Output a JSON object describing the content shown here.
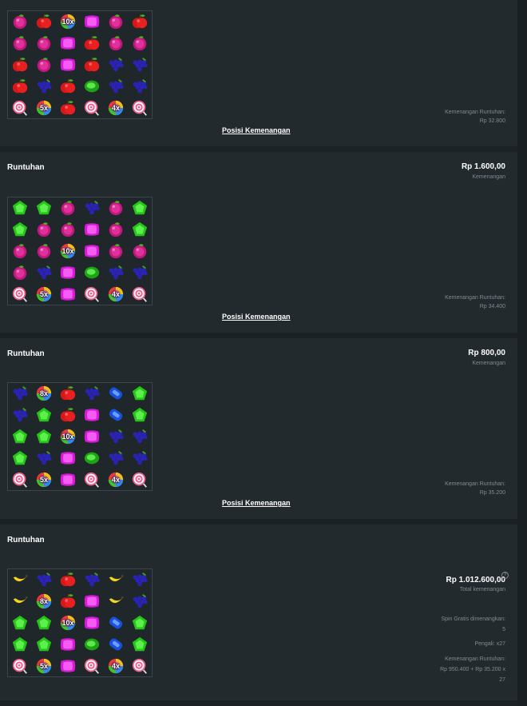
{
  "panels": [
    {
      "title": "",
      "amount": "",
      "amount_label": "",
      "link": "Posisi Kemenangan",
      "info": [
        "Kemenangan Runtuhan:",
        "Rp 32.800"
      ],
      "grid": [
        [
          "plum",
          "apple",
          "bomb:10x",
          "magenta",
          "plum",
          "apple"
        ],
        [
          "plum",
          "plum",
          "magenta",
          "apple",
          "plum",
          "plum"
        ],
        [
          "apple",
          "plum",
          "magenta",
          "apple",
          "grape",
          "grape"
        ],
        [
          "apple",
          "grape",
          "apple",
          "greencandy",
          "grape",
          "grape"
        ],
        [
          "lolly",
          "bomb:5x",
          "apple",
          "lolly",
          "bomb:4x",
          "lolly"
        ]
      ]
    },
    {
      "title": "Runtuhan",
      "amount": "Rp 1.600,00",
      "amount_label": "Kemenangan",
      "link": "Posisi Kemenangan",
      "info": [
        "Kemenangan Runtuhan:",
        "Rp 34.400"
      ],
      "grid": [
        [
          "green",
          "green",
          "plum",
          "grape",
          "plum",
          "green"
        ],
        [
          "green",
          "plum",
          "plum",
          "magenta",
          "plum",
          "green"
        ],
        [
          "plum",
          "plum",
          "bomb:10x",
          "magenta",
          "plum",
          "plum"
        ],
        [
          "plum",
          "grape",
          "magenta",
          "greencandy",
          "grape",
          "grape"
        ],
        [
          "lolly",
          "bomb:5x",
          "magenta",
          "lolly",
          "bomb:4x",
          "lolly"
        ]
      ]
    },
    {
      "title": "Runtuhan",
      "amount": "Rp 800,00",
      "amount_label": "Kemenangan",
      "link": "Posisi Kemenangan",
      "info": [
        "Kemenangan Runtuhan:",
        "Rp 35.200"
      ],
      "grid": [
        [
          "grape",
          "bomb:8x",
          "apple",
          "grape",
          "blue",
          "green"
        ],
        [
          "grape",
          "green",
          "apple",
          "magenta",
          "blue",
          "green"
        ],
        [
          "green",
          "green",
          "bomb:10x",
          "magenta",
          "grape",
          "grape"
        ],
        [
          "green",
          "grape",
          "magenta",
          "greencandy",
          "grape",
          "grape"
        ],
        [
          "lolly",
          "bomb:5x",
          "magenta",
          "lolly",
          "bomb:4x",
          "lolly"
        ]
      ]
    },
    {
      "title": "Runtuhan",
      "amount": "Rp 1.012.600,00",
      "amount_label": "Total kemenangan",
      "link": "",
      "info": [
        "Spin Gratis dimenangkan:",
        "5",
        "",
        "Pengali: x27",
        "",
        "Kemenangan Runtuhan:",
        "Rp 950.400 + Rp 35.200 x",
        "27"
      ],
      "grid": [
        [
          "banana",
          "grape",
          "apple",
          "grape",
          "banana",
          "grape"
        ],
        [
          "banana",
          "bomb:8x",
          "apple",
          "magenta",
          "banana",
          "grape"
        ],
        [
          "green",
          "green",
          "bomb:10x",
          "magenta",
          "blue",
          "green"
        ],
        [
          "green",
          "green",
          "magenta",
          "greencandy",
          "blue",
          "green"
        ],
        [
          "lolly",
          "bomb:5x",
          "magenta",
          "lolly",
          "bomb:4x",
          "lolly"
        ]
      ]
    }
  ],
  "help_icon": "?"
}
